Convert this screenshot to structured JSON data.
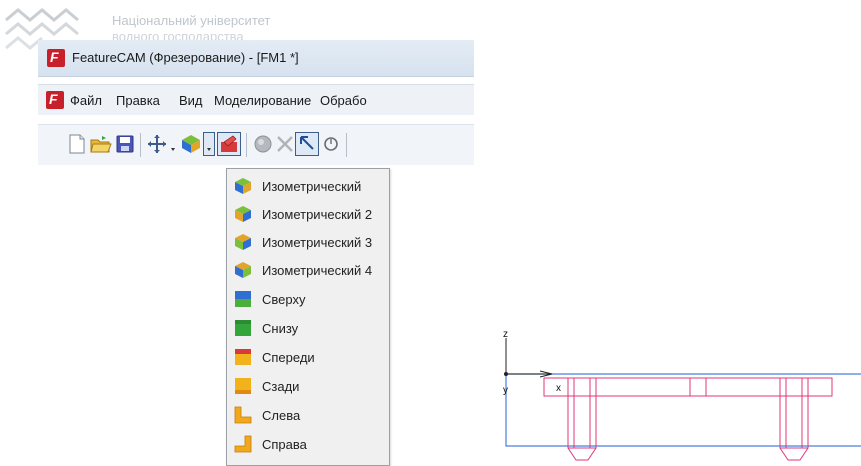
{
  "watermark": {
    "line1": "Національний університет",
    "line2": "водного господарства"
  },
  "window": {
    "title": "FeatureCAM (Фрезерование) - [FM1 *]"
  },
  "menu": {
    "items": [
      "Файл",
      "Правка",
      "Вид",
      "Моделирование",
      "Обрабо"
    ]
  },
  "toolbar": {
    "icons": [
      "new-file-icon",
      "open-folder-icon",
      "save-icon",
      "move-cross-icon",
      "view-isometric-icon",
      "dropdown-arrow-icon",
      "render-icon",
      "sphere-icon",
      "delete-x-icon",
      "select-arrow-icon",
      "rotate-icon"
    ]
  },
  "view_menu": {
    "items": [
      {
        "label": "Изометрический",
        "icon": "isometric-icon"
      },
      {
        "label": "Изометрический 2",
        "icon": "isometric-2-icon"
      },
      {
        "label": "Изометрический 3",
        "icon": "isometric-3-icon"
      },
      {
        "label": "Изометрический 4",
        "icon": "isometric-4-icon"
      },
      {
        "label": "Сверху",
        "icon": "top-view-icon"
      },
      {
        "label": "Снизу",
        "icon": "bottom-view-icon"
      },
      {
        "label": "Спереди",
        "icon": "front-view-icon"
      },
      {
        "label": "Сзади",
        "icon": "back-view-icon"
      },
      {
        "label": "Слева",
        "icon": "left-view-icon"
      },
      {
        "label": "Справа",
        "icon": "right-view-icon"
      }
    ]
  },
  "drawing": {
    "axis_z": "z",
    "axis_x": "x",
    "axis_y": "y"
  }
}
